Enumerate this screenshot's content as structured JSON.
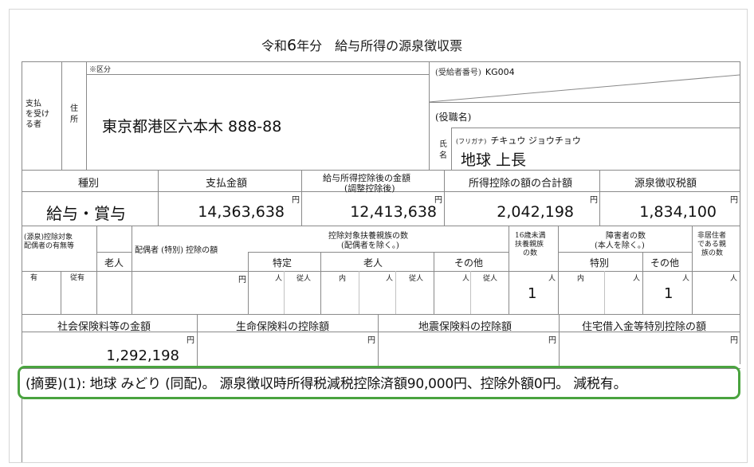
{
  "title": {
    "prefix": "令和",
    "year": "6",
    "suffix": "年分　給与所得の源泉徴収票"
  },
  "payee": {
    "side_label": [
      "支払",
      "を受け",
      "る者"
    ],
    "address_label": [
      "住",
      "所"
    ],
    "kubun_label": "※区分",
    "address": "東京都港区六本木 888-88",
    "recipient_no_label": "(受給者番号)",
    "recipient_no": "KG004",
    "position_label": "(役職名)",
    "name_label": [
      "氏",
      "名"
    ],
    "furigana_label": "(フリガナ)",
    "furigana": "チキュウ ジョウチョウ",
    "name": "地球 上長"
  },
  "amounts": {
    "shubetsu_label": "種別",
    "shiharai_label": "支払金額",
    "kyuyo_label": "給与所得控除後の金額",
    "kyuyo_sub": "(調整控除後)",
    "shotoku_kojo_label": "所得控除の額の合計額",
    "gensen_label": "源泉徴収税額",
    "shubetsu": "給与・賞与",
    "shiharai": "14,363,638",
    "kyuyo": "12,413,638",
    "shotoku_kojo": "2,042,198",
    "gensen": "1,834,100",
    "yen": "円"
  },
  "dependents": {
    "haigu_label": [
      "(源泉)控除対象",
      "配偶者の有無等"
    ],
    "rojin": "老人",
    "haigu_kojo_label": "配偶者 (特別) 控除の額",
    "fuyo_label": "控除対象扶養親族の数",
    "fuyo_sub": "(配偶者を除く。)",
    "tokutei": "特定",
    "rojin2": "老人",
    "sonota": "その他",
    "u16_label": [
      "16歳未満",
      "扶養親族",
      "の数"
    ],
    "shogai_label": "障害者の数",
    "shogai_sub": "(本人を除く。)",
    "tokubetsu": "特別",
    "sonota2": "その他",
    "hikyo_label": [
      "非居住者",
      "である親",
      "族の数"
    ],
    "ari": "有",
    "juari": "従有",
    "nin": "人",
    "junin": "従人",
    "uchi": "内",
    "u16_count": "1",
    "shogai_other_count": "1"
  },
  "insurance": {
    "shakai_label": "社会保険料等の金額",
    "seimei_label": "生命保険料の控除額",
    "jishin_label": "地震保険料の控除額",
    "jutaku_label": "住宅借入金等特別控除の額",
    "shakai": "1,292,198"
  },
  "remarks": "(摘要)(1): 地球 みどり (同配)。 源泉徴収時所得税減税控除済額90,000円、控除外額0円。 減税有。",
  "colors": {
    "highlight": "#4aa33f",
    "line": "#8a8a8a"
  }
}
